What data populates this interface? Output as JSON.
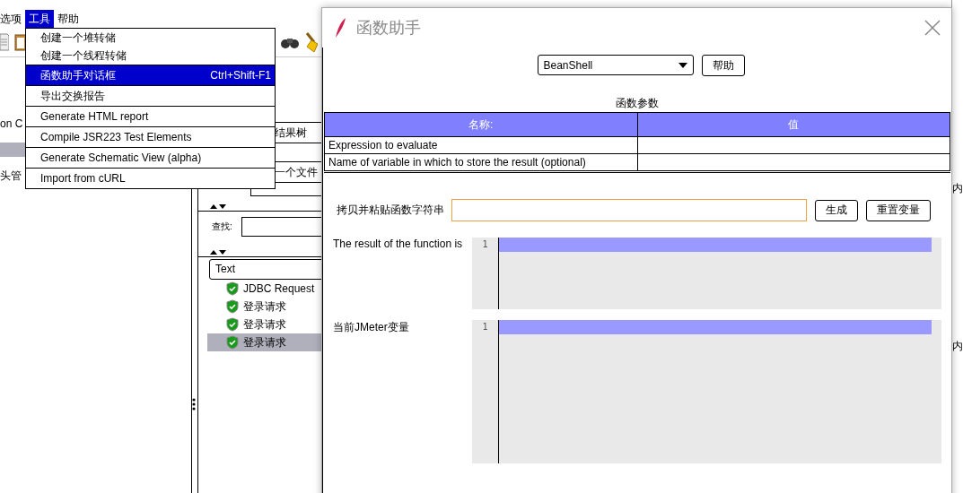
{
  "menubar": [
    {
      "label": "选项",
      "selected": false
    },
    {
      "label": "工具",
      "selected": true
    },
    {
      "label": "帮助",
      "selected": false
    }
  ],
  "tools_menu": {
    "groups": [
      [
        {
          "label": "创建一个堆转储",
          "selected": false
        },
        {
          "label": "创建一个线程转储",
          "selected": false
        }
      ],
      [
        {
          "label": "函数助手对话框",
          "shortcut": "Ctrl+Shift-F1",
          "selected": true
        }
      ],
      [
        {
          "label": "导出交换报告",
          "selected": false
        }
      ],
      [
        {
          "label": "Generate HTML report",
          "selected": false
        }
      ],
      [
        {
          "label": "Compile JSR223 Test Elements",
          "selected": false
        }
      ],
      [
        {
          "label": "Generate Schematic View (alpha)",
          "selected": false
        }
      ],
      [
        {
          "label": "Import from cURL",
          "selected": false
        }
      ]
    ]
  },
  "tree_pane": {
    "items": [
      {
        "label": "on C",
        "selected": false
      },
      {
        "selected": true
      },
      {
        "label": "头管",
        "selected": false
      }
    ]
  },
  "results_pane": {
    "title_fragment": "结果树",
    "file_fragment": "一个文件",
    "search_label": "查找:",
    "renderer": "Text",
    "samples": [
      {
        "label": "JDBC Request",
        "selected": false
      },
      {
        "label": "登录请求",
        "selected": false
      },
      {
        "label": "登录请求",
        "selected": false
      },
      {
        "label": "登录请求",
        "selected": true
      }
    ]
  },
  "right_edge": [
    "内",
    "内"
  ],
  "dialog": {
    "title": "函数助手",
    "function": "BeanShell",
    "help_button": "帮助",
    "params_caption": "函数参数",
    "table": {
      "columns": [
        "名称:",
        "值"
      ],
      "rows": [
        [
          "Expression to evaluate",
          ""
        ],
        [
          "Name of variable in which to store the result (optional)",
          ""
        ]
      ]
    },
    "copy_label": "拷贝并粘贴函数字符串",
    "generate_button": "生成",
    "reset_button": "重置变量",
    "result_label": "The result of the function is",
    "result_line": "1",
    "vars_label": "当前JMeter变量",
    "vars_line": "1"
  }
}
